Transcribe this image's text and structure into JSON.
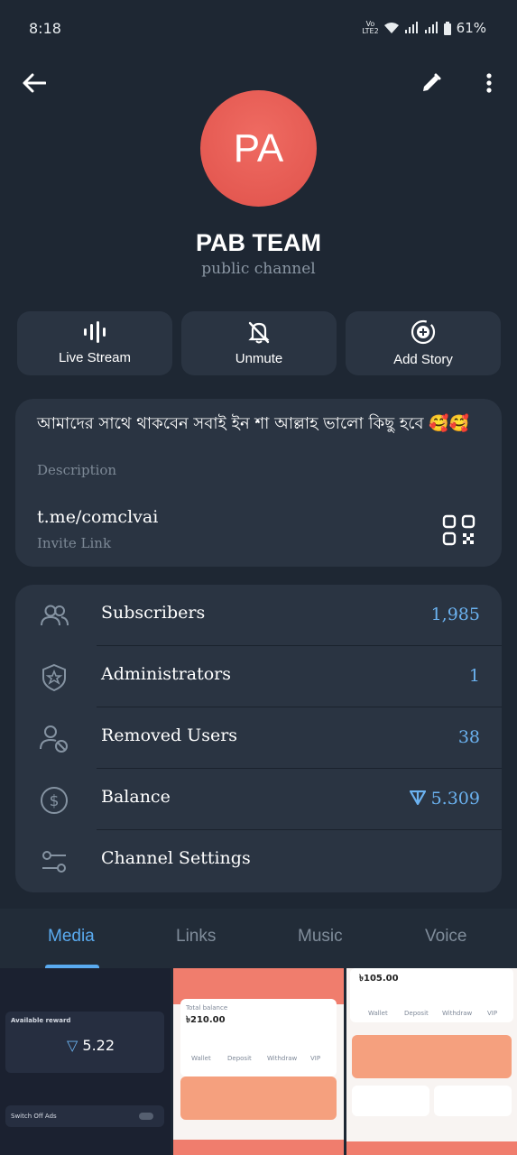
{
  "status": {
    "time": "8:18",
    "volte": "Vo LTE2",
    "battery": "61%"
  },
  "topbar": {
    "back": "back-arrow-icon",
    "edit": "pencil-icon",
    "more": "more-vertical-icon"
  },
  "channel": {
    "avatar_initials": "PA",
    "avatar_color": "#e8584f",
    "title": "PAB TEAM",
    "subtitle": "public channel"
  },
  "actions": [
    {
      "label": "Live Stream",
      "icon": "live-stream-icon"
    },
    {
      "label": "Unmute",
      "icon": "bell-off-icon"
    },
    {
      "label": "Add Story",
      "icon": "add-story-icon"
    }
  ],
  "info": {
    "description": "আমাদের সাথে থাকবেন সবাই ইন শা আল্লাহ ভালো কিছু হবে 🥰🥰",
    "description_label": "Description",
    "link": "t.me/comclvai",
    "link_label": "Invite Link"
  },
  "rows": [
    {
      "label": "Subscribers",
      "value": "1,985",
      "icon": "users-icon"
    },
    {
      "label": "Administrators",
      "value": "1",
      "icon": "shield-star-icon"
    },
    {
      "label": "Removed Users",
      "value": "38",
      "icon": "user-blocked-icon"
    },
    {
      "label": "Balance",
      "value": "5.309",
      "icon": "dollar-circle-icon"
    },
    {
      "label": "Channel Settings",
      "value": "",
      "icon": "settings-sliders-icon"
    }
  ],
  "tabs": [
    {
      "label": "Media",
      "active": true
    },
    {
      "label": "Links",
      "active": false
    },
    {
      "label": "Music",
      "active": false
    },
    {
      "label": "Voice",
      "active": false
    }
  ],
  "media": {
    "thumb1": {
      "heading": "Available reward",
      "value": "5.22",
      "toggle_label": "Switch Off Ads"
    },
    "thumb2": {
      "caption": "Total balance",
      "amount": "৳210.00",
      "buttons": [
        "Wallet",
        "Deposit",
        "Withdraw",
        "VIP"
      ]
    },
    "thumb3": {
      "amount": "৳105.00",
      "buttons": [
        "Wallet",
        "Deposit",
        "Withdraw",
        "VIP"
      ]
    }
  },
  "colors": {
    "background": "#1e2733",
    "card": "#2a3442",
    "accent": "#5aabf0",
    "value_blue": "#6bb2f0"
  }
}
